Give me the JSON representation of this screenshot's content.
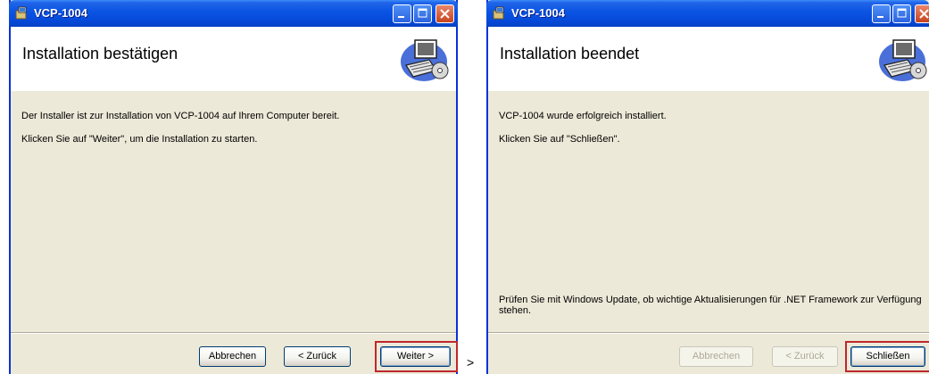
{
  "left_window": {
    "title": "VCP-1004",
    "header_title": "Installation bestätigen",
    "line1": "Der Installer ist zur Installation von VCP-1004 auf Ihrem Computer bereit.",
    "line2": "Klicken Sie auf \"Weiter\", um die Installation zu starten.",
    "buttons": {
      "cancel": "Abbrechen",
      "back": "< Zurück",
      "next": "Weiter >"
    }
  },
  "right_window": {
    "title": "VCP-1004",
    "header_title": "Installation beendet",
    "line1": "VCP-1004 wurde erfolgreich installiert.",
    "line2": "Klicken Sie auf \"Schließen\".",
    "update_note": "Prüfen Sie mit Windows Update, ob wichtige Aktualisierungen für .NET Framework zur Verfügung stehen.",
    "buttons": {
      "cancel": "Abbrechen",
      "back": "< Zurück",
      "close": "Schließen"
    }
  },
  "arrow": ">",
  "colors": {
    "titlebar": "#0a54e3",
    "highlight": "#c0272d",
    "dialog_bg": "#ece9d8"
  }
}
